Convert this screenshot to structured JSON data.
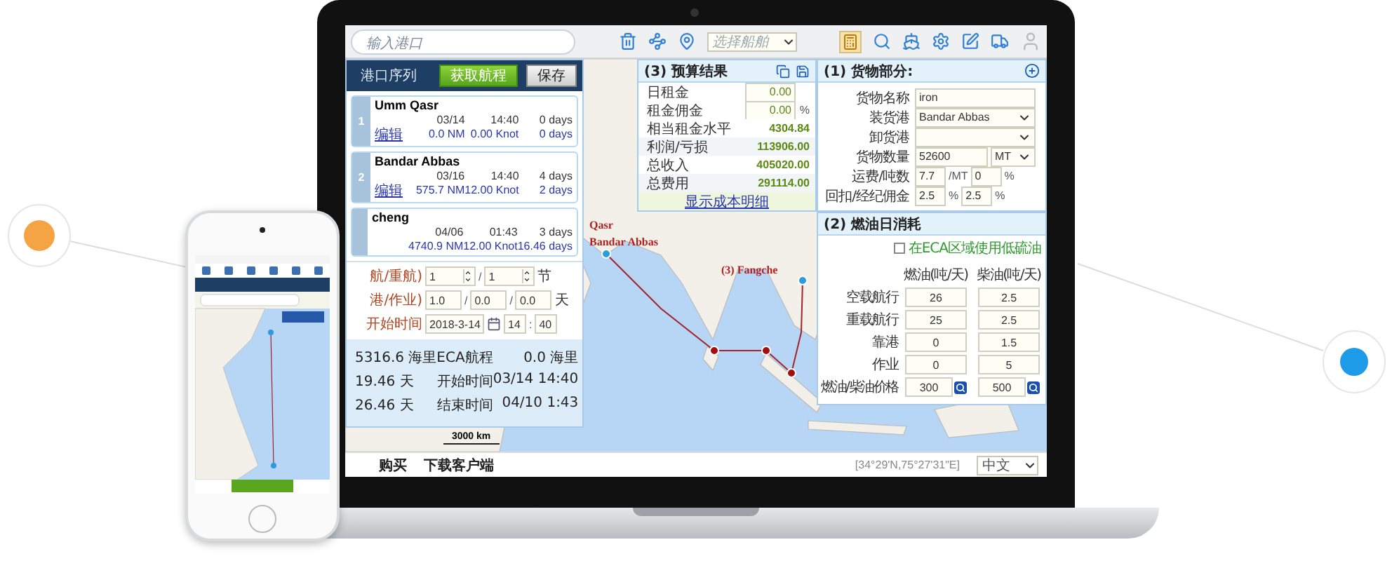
{
  "toolbar": {
    "search_placeholder": "输入港口",
    "vessel_select": {
      "placeholder": "选择船舶"
    }
  },
  "port_panel": {
    "title": "港口序列",
    "buttons": [
      "获取航程",
      "保存"
    ],
    "ports": [
      {
        "number": "1",
        "name": "Umm Qasr",
        "date": "03/14",
        "time": "14:40",
        "days": "0 days",
        "edit": "编辑",
        "distance": "0.0 NM",
        "speed": "0.00 Knot",
        "sea_days": "0 days"
      },
      {
        "number": "2",
        "name": "Bandar Abbas",
        "date": "03/16",
        "time": "14:40",
        "days": "4 days",
        "edit": "编辑",
        "distance": "575.7 NM",
        "speed": "12.00 Knot",
        "sea_days": "2 days"
      },
      {
        "name": "cheng",
        "date": "04/06",
        "time": "01:43",
        "days": "3 days",
        "distance": "4740.9 NM",
        "speed": "12.00 Knot",
        "sea_days": "16.46 days"
      }
    ]
  },
  "voyage_form": [
    {
      "label": "航/重航)",
      "kind": "spinners",
      "fields": [
        "1",
        "1"
      ],
      "separator": "/",
      "unit": "节"
    },
    {
      "label": "港/作业)",
      "kind": "inputs",
      "fields": [
        "1.0",
        "0.0",
        "0.0"
      ],
      "separator": "/",
      "unit": "天"
    },
    {
      "label": "开始时间",
      "kind": "datetime",
      "fields": [
        "2018-3-14",
        "14",
        "40"
      ],
      "separator": ":"
    }
  ],
  "summary": [
    {
      "value": "5316.6 海里",
      "label": "ECA航程",
      "detail": "0.0 海里"
    },
    {
      "value": "19.46 天",
      "label": "开始时间",
      "detail": "03/14 14:40"
    },
    {
      "value": "26.46 天",
      "label": "结束时间",
      "detail": "04/10 1:43"
    }
  ],
  "budget": {
    "title": "(3) 预算结果",
    "rows": [
      {
        "label": "日租金",
        "kind": "input",
        "value": "0.00"
      },
      {
        "label": "租金佣金",
        "kind": "input",
        "value": "0.00",
        "unit": "%"
      },
      {
        "label": "相当租金水平",
        "kind": "value",
        "value": "4304.84"
      },
      {
        "label": "利润/亏损",
        "kind": "value",
        "value": "113906.00"
      },
      {
        "label": "总收入",
        "kind": "value",
        "value": "405020.00"
      },
      {
        "label": "总费用",
        "kind": "value",
        "value": "291114.00"
      }
    ],
    "link": "显示成本明细"
  },
  "cargo": {
    "title": "(1) 货物部分:",
    "rows": [
      {
        "label": "货物名称",
        "kind": "text",
        "value": "iron"
      },
      {
        "label": "装货港",
        "kind": "select",
        "value": "Bandar Abbas"
      },
      {
        "label": "卸货港",
        "kind": "select"
      },
      {
        "label": "货物数量",
        "kind": "quantity",
        "value": "52600",
        "unit": "MT"
      },
      {
        "label": "运费/吨数",
        "kind": "pair",
        "values": [
          "7.7",
          "0"
        ],
        "units": [
          "/MT",
          "%"
        ]
      },
      {
        "label": "回扣/经纪佣金",
        "kind": "pair",
        "values": [
          "2.5",
          "2.5"
        ],
        "units": [
          "%",
          "%"
        ]
      }
    ]
  },
  "fuel": {
    "title": "(2) 燃油日消耗",
    "eca_option": {
      "label": "在ECA区域使用低硫油",
      "checked": false
    },
    "columns": [
      "燃油(吨/天)",
      "柴油(吨/天)"
    ],
    "rows": [
      {
        "label": "空载航行",
        "values": [
          "26",
          "2.5"
        ]
      },
      {
        "label": "重载航行",
        "values": [
          "25",
          "2.5"
        ]
      },
      {
        "label": "靠港",
        "values": [
          "0",
          "1.5"
        ]
      },
      {
        "label": "作业",
        "values": [
          "0",
          "5"
        ]
      }
    ],
    "price_row": {
      "label": "燃油/柴油价格",
      "values": [
        "300",
        "500"
      ]
    }
  },
  "map": {
    "labels": [
      "Qasr",
      "Bandar Abbas",
      "(3) Fangche"
    ],
    "scale": "3000 km"
  },
  "footer": {
    "links": [
      "购买",
      "下载客户端"
    ],
    "coordinates": "[34°29'N,75°27'31\"E]",
    "language": "中文"
  }
}
